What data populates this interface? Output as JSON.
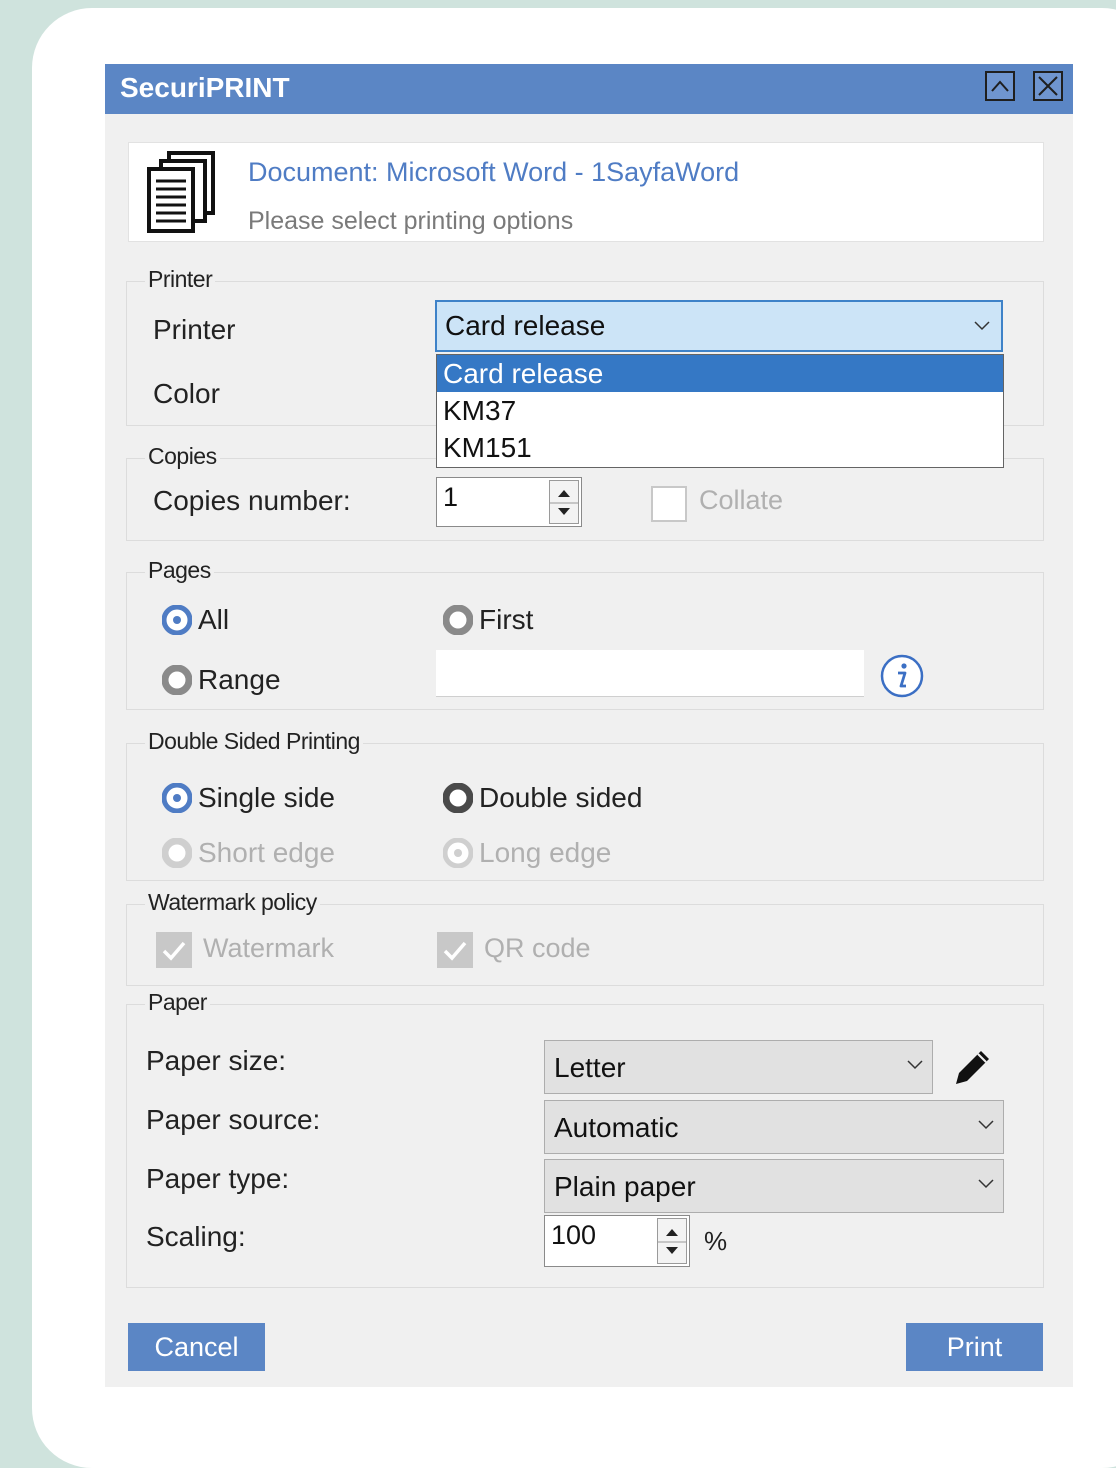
{
  "window": {
    "title": "SecuriPRINT"
  },
  "header": {
    "document": "Document: Microsoft Word - 1SayfaWord",
    "subtitle": "Please select printing options"
  },
  "printer_group": {
    "legend": "Printer",
    "printer_label": "Printer",
    "printer_value": "Card release",
    "printer_options": [
      "Card release",
      "KM37",
      "KM151"
    ],
    "color_label": "Color"
  },
  "copies_group": {
    "legend": "Copies",
    "copies_label": "Copies number:",
    "copies_value": "1",
    "collate_label": "Collate"
  },
  "pages_group": {
    "legend": "Pages",
    "all_label": "All",
    "first_label": "First",
    "range_label": "Range",
    "range_value": ""
  },
  "duplex_group": {
    "legend": "Double Sided Printing",
    "single_label": "Single side",
    "double_label": "Double sided",
    "short_label": "Short edge",
    "long_label": "Long edge"
  },
  "watermark_group": {
    "legend": "Watermark policy",
    "watermark_label": "Watermark",
    "qr_label": "QR code"
  },
  "paper_group": {
    "legend": "Paper",
    "size_label": "Paper size:",
    "size_value": "Letter",
    "source_label": "Paper source:",
    "source_value": "Automatic",
    "type_label": "Paper type:",
    "type_value": "Plain paper",
    "scaling_label": "Scaling:",
    "scaling_value": "100",
    "scaling_unit": "%"
  },
  "actions": {
    "cancel": "Cancel",
    "print": "Print"
  },
  "colors": {
    "accent": "#5b86c5",
    "selection": "#3578c5",
    "link": "#4f7cc4"
  }
}
